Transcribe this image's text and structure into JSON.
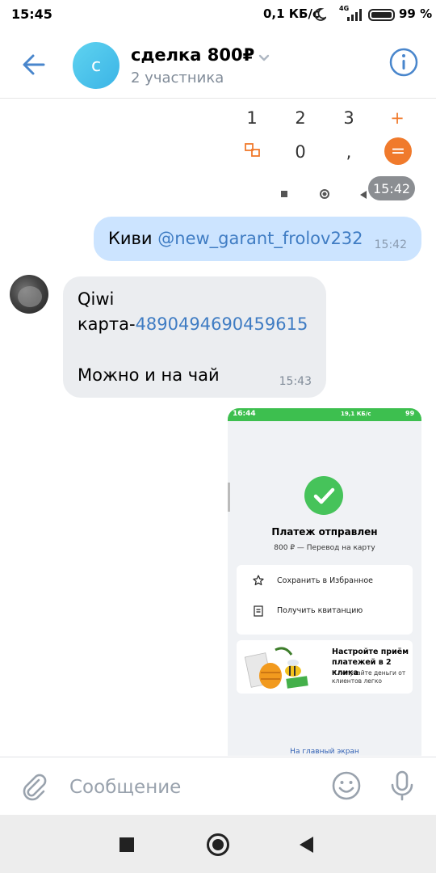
{
  "status_bar": {
    "time": "15:45",
    "speed": "0,1 КБ/с",
    "network": "4G",
    "battery": "99 %"
  },
  "header": {
    "title": "сделка 800₽",
    "subtitle": "2 участника",
    "back_icon": "arrow-left-icon",
    "avatar_letter": "с",
    "info_icon": "info-icon",
    "accent": "#4986cc"
  },
  "calculator": {
    "keys": [
      "1",
      "2",
      "3",
      "+",
      "0",
      ","
    ],
    "equals": "=",
    "time": "15:42"
  },
  "messages": [
    {
      "direction": "out",
      "text": "Киви ",
      "mention": "@new_garant_frolov232",
      "time": "15:42"
    },
    {
      "direction": "in",
      "line1": "Qiwi",
      "line2_prefix": "карта-",
      "card_number": "4890494690459615",
      "line3": "Можно и на чай",
      "time": "15:43"
    }
  ],
  "attachment": {
    "status_time": "16:44",
    "status_right": "19,1 КБ/с",
    "status_battery": "99",
    "heading": "Платеж отправлен",
    "sub": "800 ₽ — Перевод на карту",
    "actions": [
      "Сохранить в Избранное",
      "Получить квитанцию"
    ],
    "promo_title": "Настройте приём платежей в 2 клика",
    "promo_sub": "И получайте деньги от клиентов легко",
    "home_link": "На главный экран"
  },
  "composer": {
    "placeholder": "Сообщение"
  }
}
